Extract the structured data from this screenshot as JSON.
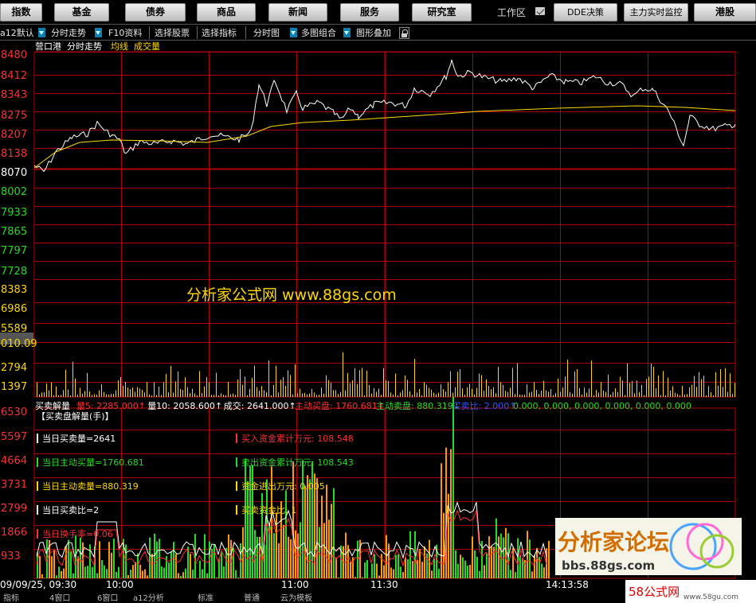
{
  "nav": {
    "buttons": [
      "指数",
      "基金",
      "债券",
      "商品",
      "新闻",
      "服务",
      "研究室"
    ],
    "workarea_label": "工作区",
    "right_buttons": [
      "DDE决策",
      "主力实时监控",
      "港股"
    ]
  },
  "toolbar": {
    "items": [
      "a12默认",
      "分时走势",
      "F10资料",
      "选择股票",
      "选择指标",
      "分时图",
      "多图组合",
      "图形叠加"
    ]
  },
  "header": {
    "stock_name": "营口港",
    "view_name": "分时走势",
    "avg_label": "均线",
    "vol_label": "成交量"
  },
  "price_axis": {
    "labels": [
      "8480",
      "8412",
      "8343",
      "8275",
      "8207",
      "8138",
      "8070",
      "8002",
      "7933",
      "7865",
      "7797",
      "7728"
    ],
    "colors": [
      "#ff3030",
      "#ff3030",
      "#ff3030",
      "#ff3030",
      "#ff3030",
      "#ff3030",
      "#ffffff",
      "#22dd22",
      "#22dd22",
      "#22dd22",
      "#22dd22",
      "#22dd22"
    ]
  },
  "volume_axis": {
    "labels": [
      "8383",
      "6986",
      "5589",
      "010.09",
      "2794",
      "1397"
    ]
  },
  "watermark_text": "分析家公式网 www.88gs.com",
  "indicator_header": {
    "title": "买卖解量",
    "items": [
      {
        "text": "量5: 2285.000↑",
        "color": "#ff3030"
      },
      {
        "text": "量10: 2058.600↑",
        "color": "#ffffff"
      },
      {
        "text": "成交: 2641.000↑",
        "color": "#ffffff"
      },
      {
        "text": "主动买盘: 1760.681↑",
        "color": "#ff3030"
      },
      {
        "text": "主动卖盘: 880.319↓",
        "color": "#22dd22"
      },
      {
        "text": "买卖比: 2.000↑",
        "color": "#3355ff"
      },
      {
        "text": "0.000, 0.000, 0.000, 0.000, 0.000, 0.000",
        "color": "#22dd22"
      }
    ]
  },
  "indicator_axis": {
    "labels": [
      "6530",
      "5597",
      "4664",
      "3731",
      "2799",
      "1866",
      "933"
    ]
  },
  "panel_title": "【买卖盘解量(手)】",
  "info_left": [
    {
      "text": "当日买卖量=2641",
      "color": "#ffffff"
    },
    {
      "text": "当日主动买量=1760.681",
      "color": "#22dd22"
    },
    {
      "text": "当日主动卖量=880.319",
      "color": "#ffd700"
    },
    {
      "text": "当日买卖比=2",
      "color": "#ffffff"
    },
    {
      "text": "当日换手率=0.06",
      "color": "#ff3030"
    }
  ],
  "info_right": [
    {
      "text": "买入资金累计万元: 108.548",
      "color": "#ff3030"
    },
    {
      "text": "卖出资金累计万元: 108.543",
      "color": "#22dd22"
    },
    {
      "text": "资金进出万元: 0.005",
      "color": "#ffd700"
    },
    {
      "text": "买卖资金比: 1",
      "color": "#ffd700"
    }
  ],
  "time_axis": {
    "labels": [
      "09/09/25, 09:30",
      "10:00",
      "11:00",
      "11:30",
      "14:13:58"
    ]
  },
  "bottom_tabs": [
    "指标",
    "4窗口",
    "6窗口",
    "a12分析",
    "标准",
    "普通",
    "云为模板"
  ],
  "logo": {
    "title": "分析家论坛",
    "url": "bbs.88gs.com",
    "site": "58公式网",
    "site_url": "www.58gu.com"
  },
  "colors": {
    "grid": "#b00000",
    "price_line": "#ffffff",
    "avg_line": "#ffd700",
    "volume_bar": "#ffd700",
    "buy_bar": "#22dd22",
    "sell_bar": "#ff9a00",
    "dde_line": "#ff3030"
  }
}
